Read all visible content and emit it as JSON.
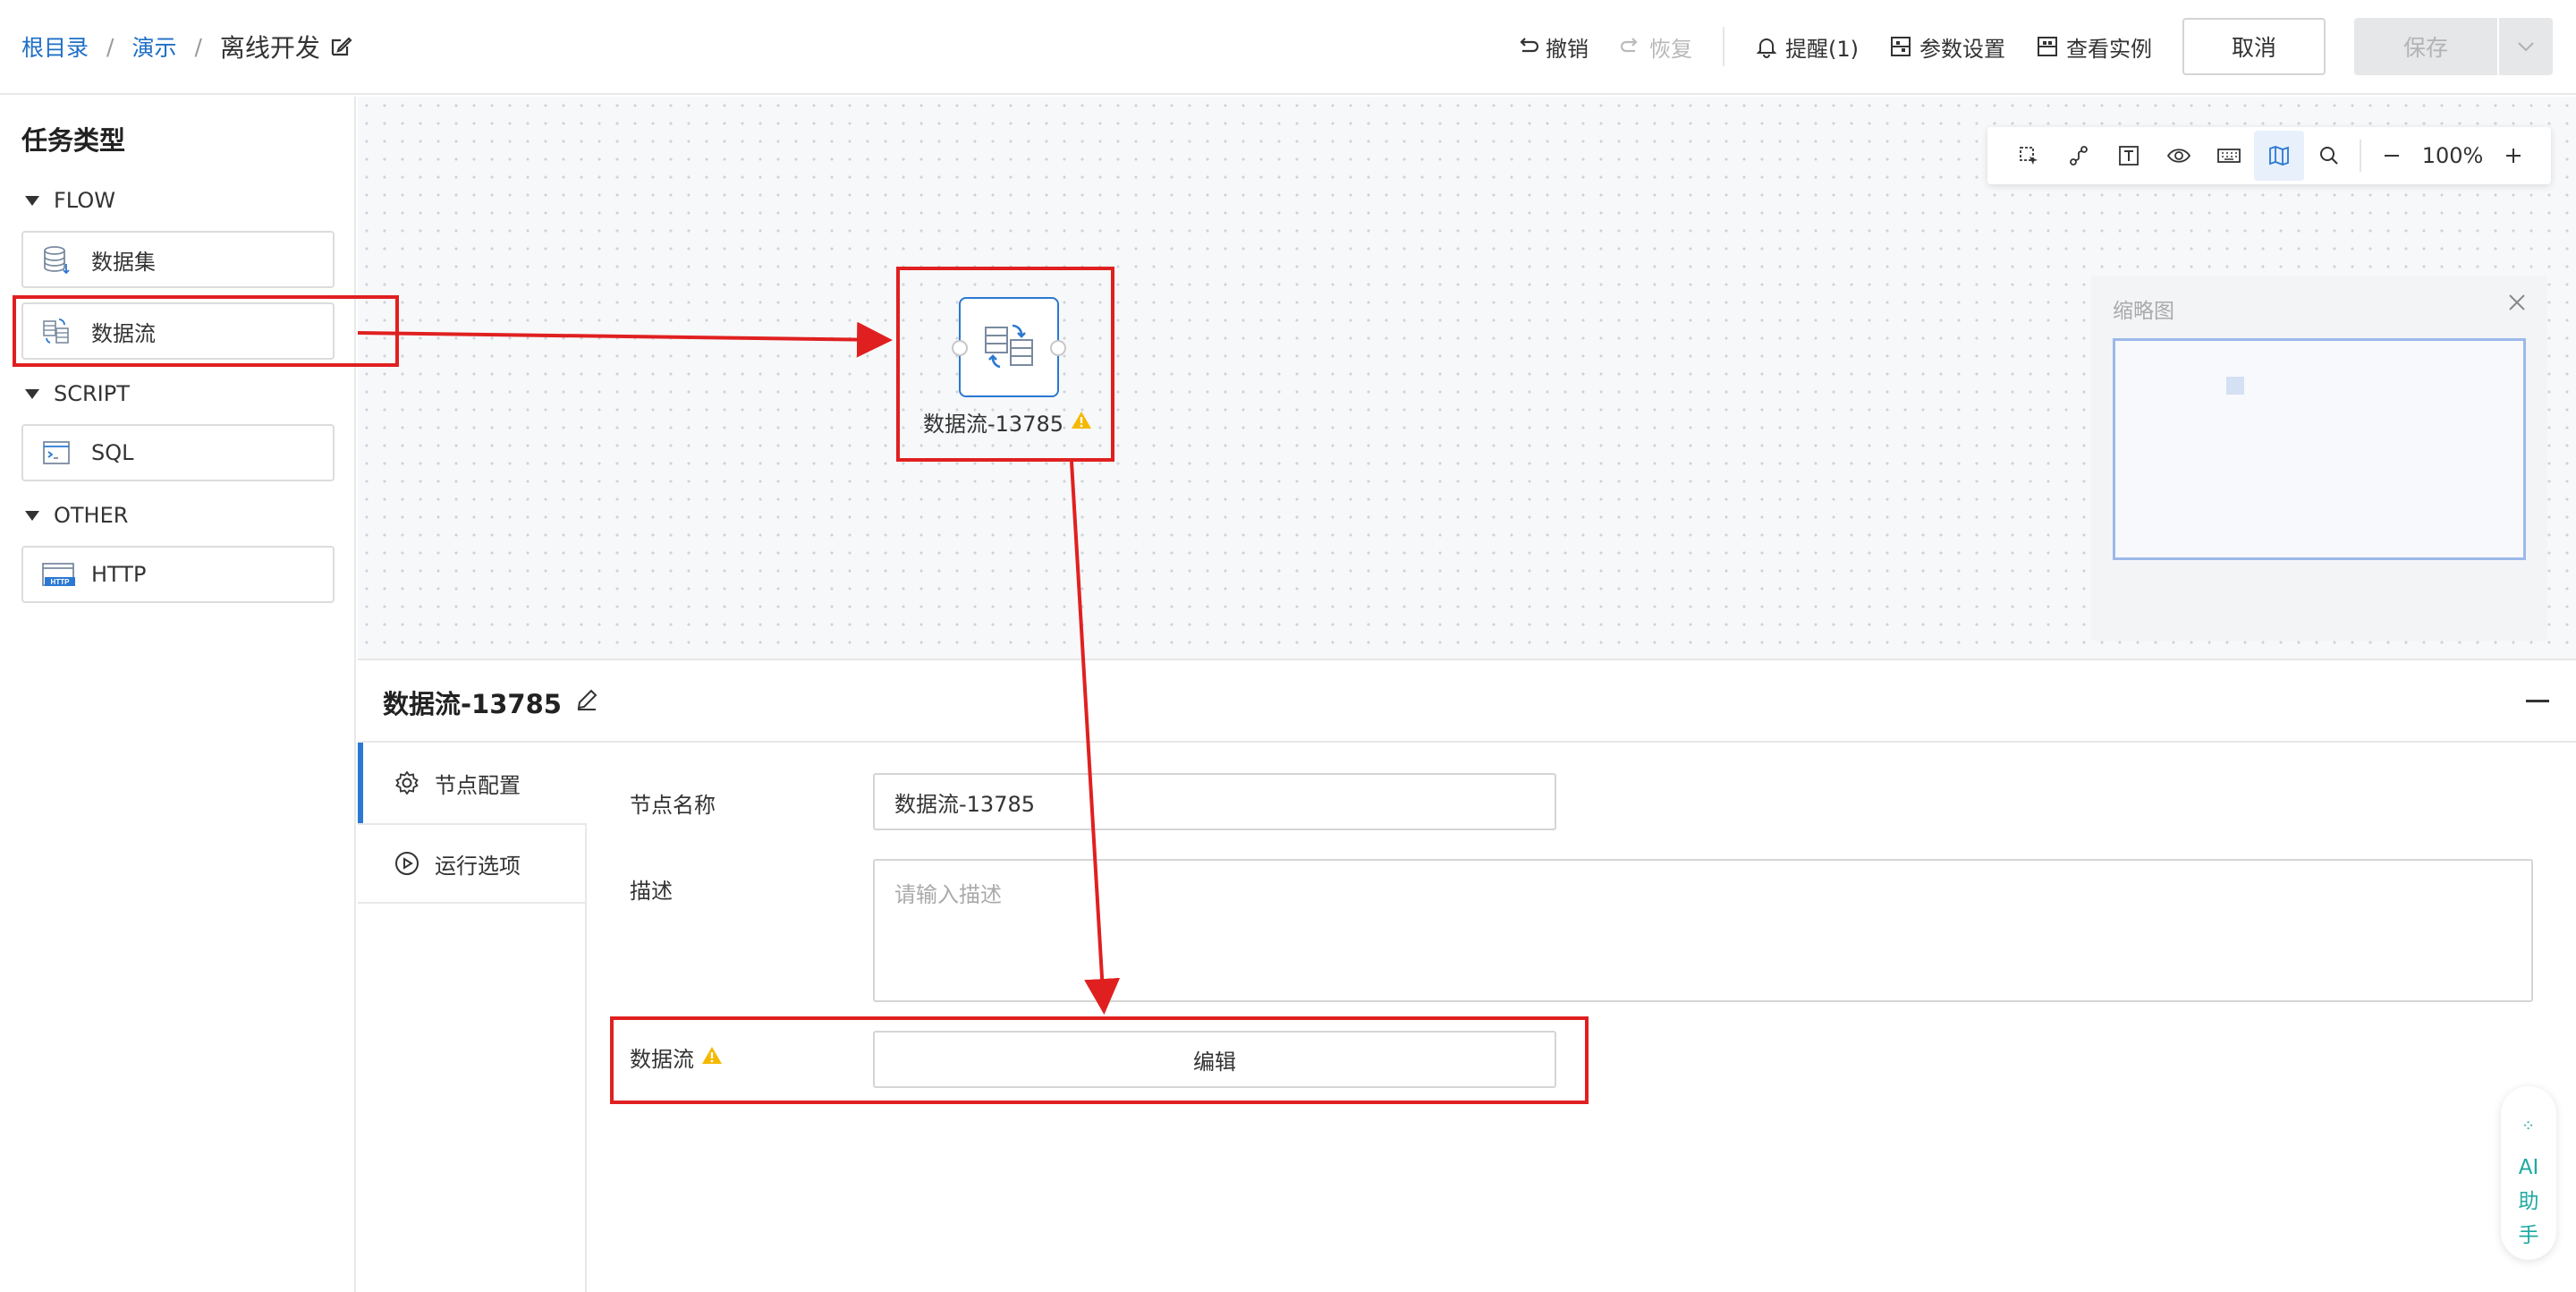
{
  "header": {
    "breadcrumbs": [
      "根目录",
      "演示",
      "离线开发"
    ],
    "separator": "/",
    "undo": "撤销",
    "redo": "恢复",
    "remind": "提醒(1)",
    "params": "参数设置",
    "instances": "查看实例",
    "cancel": "取消",
    "save": "保存"
  },
  "sidebar": {
    "title": "任务类型",
    "groups": [
      {
        "name": "FLOW",
        "items": [
          {
            "label": "数据集",
            "icon": "database-icon"
          },
          {
            "label": "数据流",
            "icon": "dataflow-icon"
          }
        ]
      },
      {
        "name": "SCRIPT",
        "items": [
          {
            "label": "SQL",
            "icon": "terminal-icon"
          }
        ]
      },
      {
        "name": "OTHER",
        "items": [
          {
            "label": "HTTP",
            "icon": "http-icon"
          }
        ]
      }
    ]
  },
  "canvas": {
    "zoom_level": "100%",
    "tools": [
      "select-area-icon",
      "connect-icon",
      "text-icon",
      "eye-icon",
      "keyboard-icon",
      "map-icon",
      "search-icon",
      "zoom-out-icon",
      "zoom-in-icon"
    ],
    "node": {
      "label": "数据流-13785",
      "status": "warning"
    },
    "minimap": {
      "title": "缩略图"
    }
  },
  "panel": {
    "title": "数据流-13785",
    "tabs": [
      "节点配置",
      "运行选项"
    ],
    "fields": {
      "node_name_label": "节点名称",
      "node_name_value": "数据流-13785",
      "desc_label": "描述",
      "desc_placeholder": "请输入描述",
      "dataflow_label": "数据流",
      "edit_button": "编辑"
    }
  },
  "ai_assistant": {
    "label_lines": [
      "AI",
      "助",
      "手"
    ]
  },
  "colors": {
    "accent": "#2a78d3",
    "annotation": "#e02020",
    "warning": "#f5b800",
    "ai": "#1fa9a2"
  }
}
